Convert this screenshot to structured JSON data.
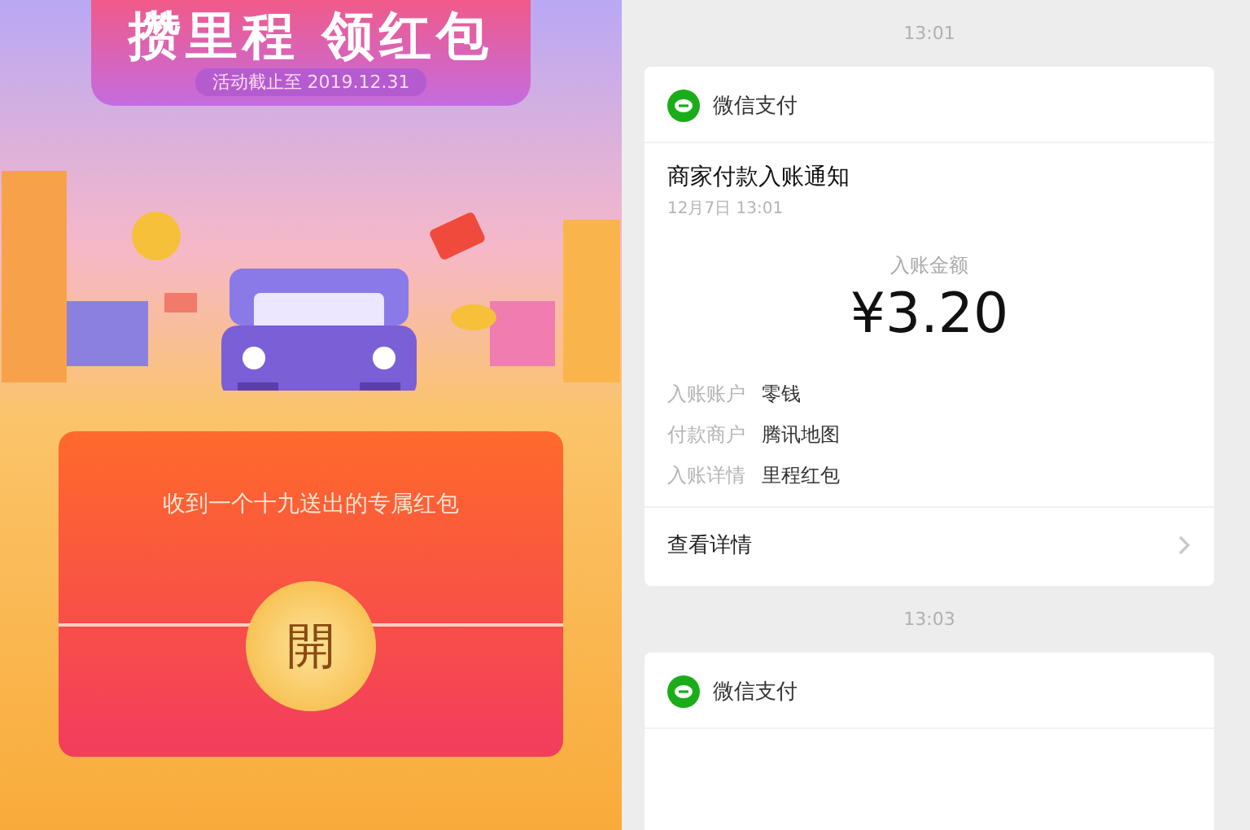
{
  "promo": {
    "title": "攒里程 领红包",
    "subtitle": "活动截止至 2019.12.31",
    "envelope": {
      "message": "收到一个十九送出的专属红包",
      "open_button": "開"
    }
  },
  "chat": {
    "items": [
      {
        "kind": "time",
        "text": "13:01"
      },
      {
        "kind": "card",
        "sender": "微信支付",
        "title": "商家付款入账通知",
        "date": "12月7日 13:01",
        "amount_label": "入账金额",
        "amount": "¥3.20",
        "fields": [
          {
            "label": "入账账户",
            "value": "零钱"
          },
          {
            "label": "付款商户",
            "value": "腾讯地图"
          },
          {
            "label": "入账详情",
            "value": "里程红包"
          }
        ],
        "link": "查看详情"
      },
      {
        "kind": "time",
        "text": "13:03"
      },
      {
        "kind": "card",
        "sender": "微信支付"
      }
    ]
  }
}
